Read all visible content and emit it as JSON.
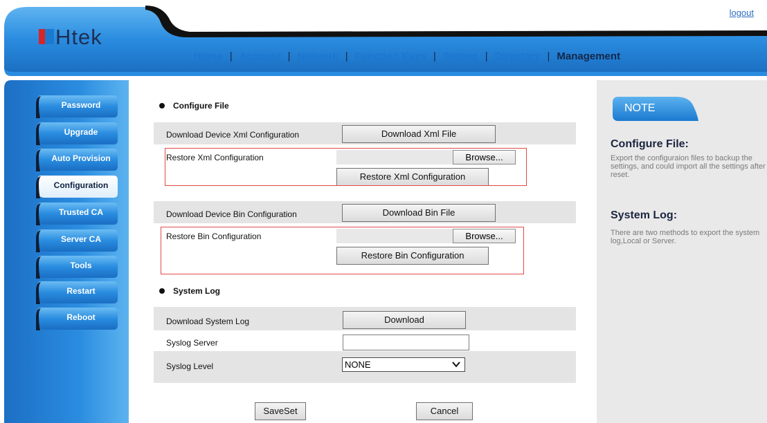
{
  "header": {
    "logo_text": "Htek",
    "logout": "logout",
    "nav": [
      "Home",
      "Account",
      "Network",
      "Function Keys",
      "Setting",
      "Directory",
      "Management"
    ],
    "active_nav": "Management"
  },
  "sidebar": {
    "items": [
      {
        "label": "Password"
      },
      {
        "label": "Upgrade"
      },
      {
        "label": "Auto Provision"
      },
      {
        "label": "Configuration"
      },
      {
        "label": "Trusted CA"
      },
      {
        "label": "Server CA"
      },
      {
        "label": "Tools"
      },
      {
        "label": "Restart"
      },
      {
        "label": "Reboot"
      }
    ],
    "active": "Configuration"
  },
  "main": {
    "configure_file": {
      "title": "Configure File",
      "download_xml_label": "Download Device Xml Configuration",
      "download_xml_button": "Download Xml File",
      "restore_xml_label": "Restore Xml Configuration",
      "browse_xml_button": "Browse...",
      "restore_xml_button": "Restore Xml Configuration",
      "download_bin_label": "Download Device Bin Configuration",
      "download_bin_button": "Download Bin File",
      "restore_bin_label": "Restore Bin Configuration",
      "browse_bin_button": "Browse...",
      "restore_bin_button": "Restore Bin Configuration"
    },
    "system_log": {
      "title": "System Log",
      "download_label": "Download System Log",
      "download_button": "Download",
      "server_label": "Syslog Server",
      "server_value": "",
      "level_label": "Syslog Level",
      "level_value": "NONE"
    },
    "save_button": "SaveSet",
    "cancel_button": "Cancel"
  },
  "note": {
    "tab": "NOTE",
    "sections": [
      {
        "title": "Configure File:",
        "text": "Export the configuraion files to backup the settings, and could import all the settings after reset."
      },
      {
        "title": "System Log:",
        "text": "There are two methods to export the system log,Local or Server."
      }
    ]
  },
  "colors": {
    "brand_blue": "#1b7ad0",
    "header_blue": "#2a8ce0",
    "dark_navy": "#14284a",
    "highlight_red": "#e24848",
    "row_gray": "#e4e4e4",
    "note_gray": "#e9e9e9"
  }
}
